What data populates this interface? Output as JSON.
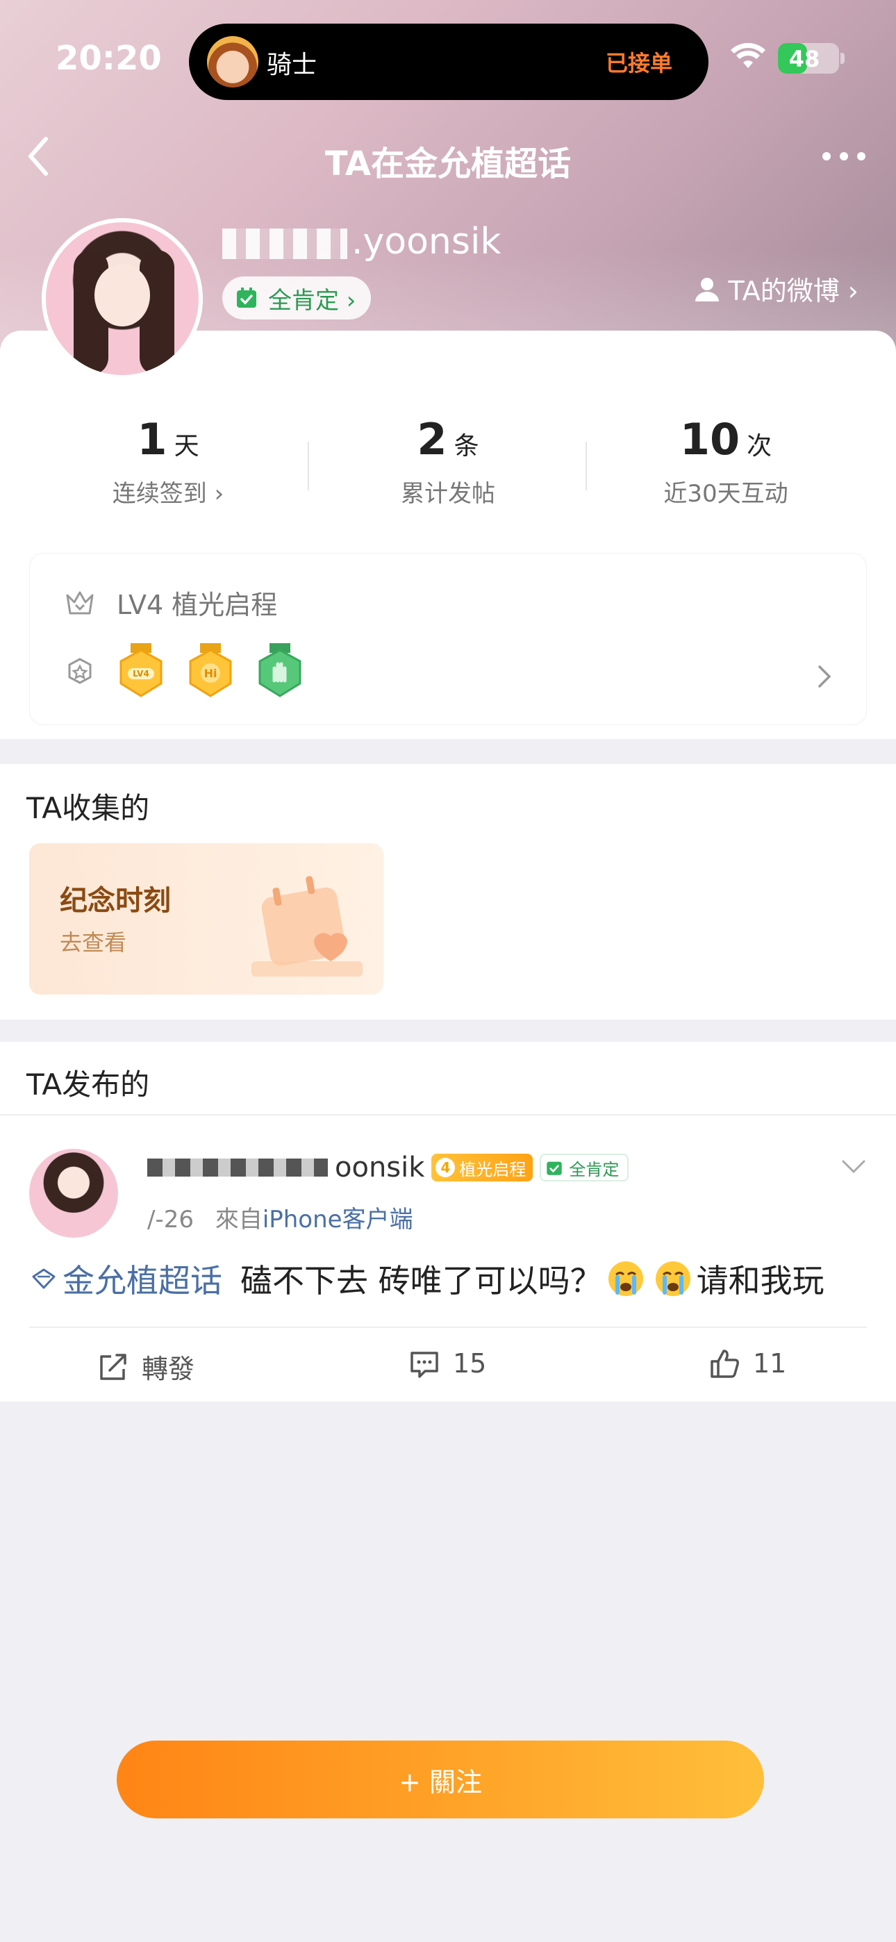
{
  "status_bar": {
    "time": "20:20",
    "island_name": "骑士",
    "island_status": "已接单",
    "battery": "48",
    "battery_level": 0.48
  },
  "nav": {
    "title": "TA在金允植超话"
  },
  "profile": {
    "username_visible": ".yoonsik",
    "badge_label": "全肯定 ›",
    "weibo_link": "TA的微博 ›"
  },
  "stats": [
    {
      "number": "1",
      "unit": "天",
      "label": "连续签到 ›"
    },
    {
      "number": "2",
      "unit": "条",
      "label": "累计发帖"
    },
    {
      "number": "10",
      "unit": "次",
      "label": "近30天互动"
    }
  ],
  "level": {
    "text": "LV4 植光启程",
    "medals": [
      "LV4",
      "Hi",
      "hand"
    ]
  },
  "collected": {
    "title": "TA收集的",
    "card_title": "纪念时刻",
    "card_sub": "去查看"
  },
  "posted": {
    "title": "TA发布的"
  },
  "post": {
    "name_suffix": "oonsik",
    "level_badge_num": "4",
    "level_badge_text": "植光启程",
    "full_badge": "全肯定",
    "date": "/-26",
    "source_prefix": "來自",
    "source": "iPhone客户端",
    "topic": "金允植超话",
    "text_a": "磕不下去 砖唯了可以吗？",
    "text_b": "请和我玩",
    "repost_label": "轉發",
    "comments": "15",
    "likes": "11"
  },
  "follow_button": "+ 關注",
  "colors": {
    "accent_orange": "#ff8515",
    "link_blue": "#4a6fa5",
    "verified_green": "#2a9b52"
  }
}
